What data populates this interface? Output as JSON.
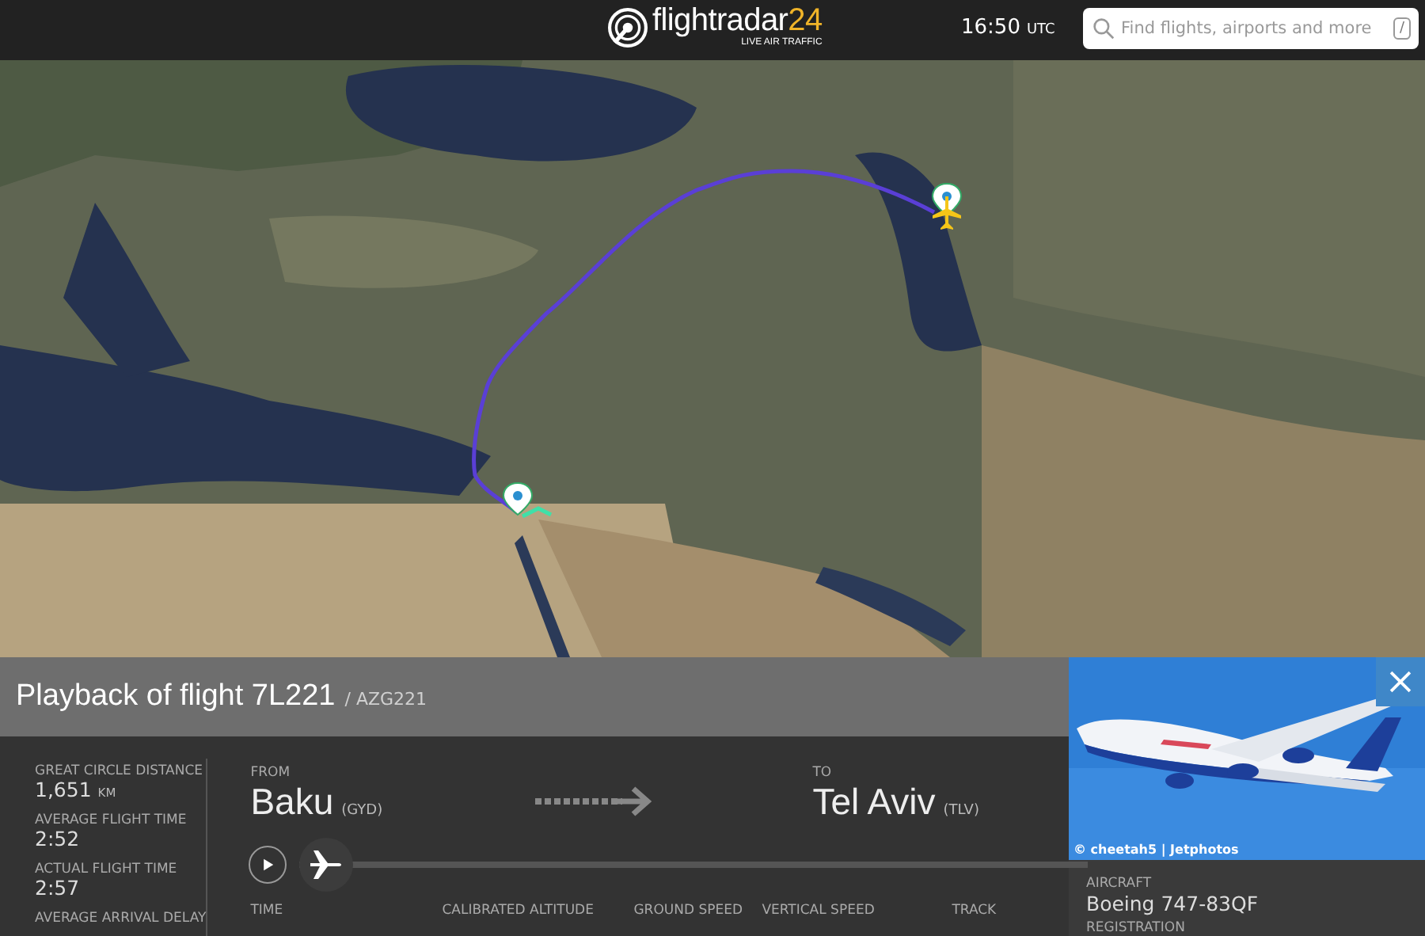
{
  "header": {
    "logo": {
      "name": "flightradar",
      "suffix": "24",
      "tagline": "LIVE AIR TRAFFIC"
    },
    "clock": {
      "time": "16:50",
      "zone": "UTC"
    },
    "search": {
      "placeholder": "Find flights, airports and more",
      "shortcut": "/"
    }
  },
  "panel": {
    "title": "Playback of flight 7L221",
    "subtitle": "/ AZG221",
    "stats": [
      {
        "label": "GREAT CIRCLE DISTANCE",
        "value": "1,651",
        "unit": "KM"
      },
      {
        "label": "AVERAGE FLIGHT TIME",
        "value": "2:52"
      },
      {
        "label": "ACTUAL FLIGHT TIME",
        "value": "2:57"
      },
      {
        "label": "AVERAGE ARRIVAL DELAY"
      }
    ],
    "from": {
      "label": "FROM",
      "city": "Baku",
      "code": "(GYD)"
    },
    "to": {
      "label": "TO",
      "city": "Tel Aviv",
      "code": "(TLV)"
    },
    "playback": {
      "level": 0
    },
    "columns": [
      "TIME",
      "CALIBRATED ALTITUDE",
      "GROUND SPEED",
      "VERTICAL SPEED",
      "TRACK"
    ],
    "photo": {
      "credit": "© cheetah5 | Jetphotos"
    },
    "aircraft": {
      "label": "AIRCRAFT",
      "value": "Boeing 747-83QF"
    },
    "registration": {
      "label": "REGISTRATION"
    }
  }
}
